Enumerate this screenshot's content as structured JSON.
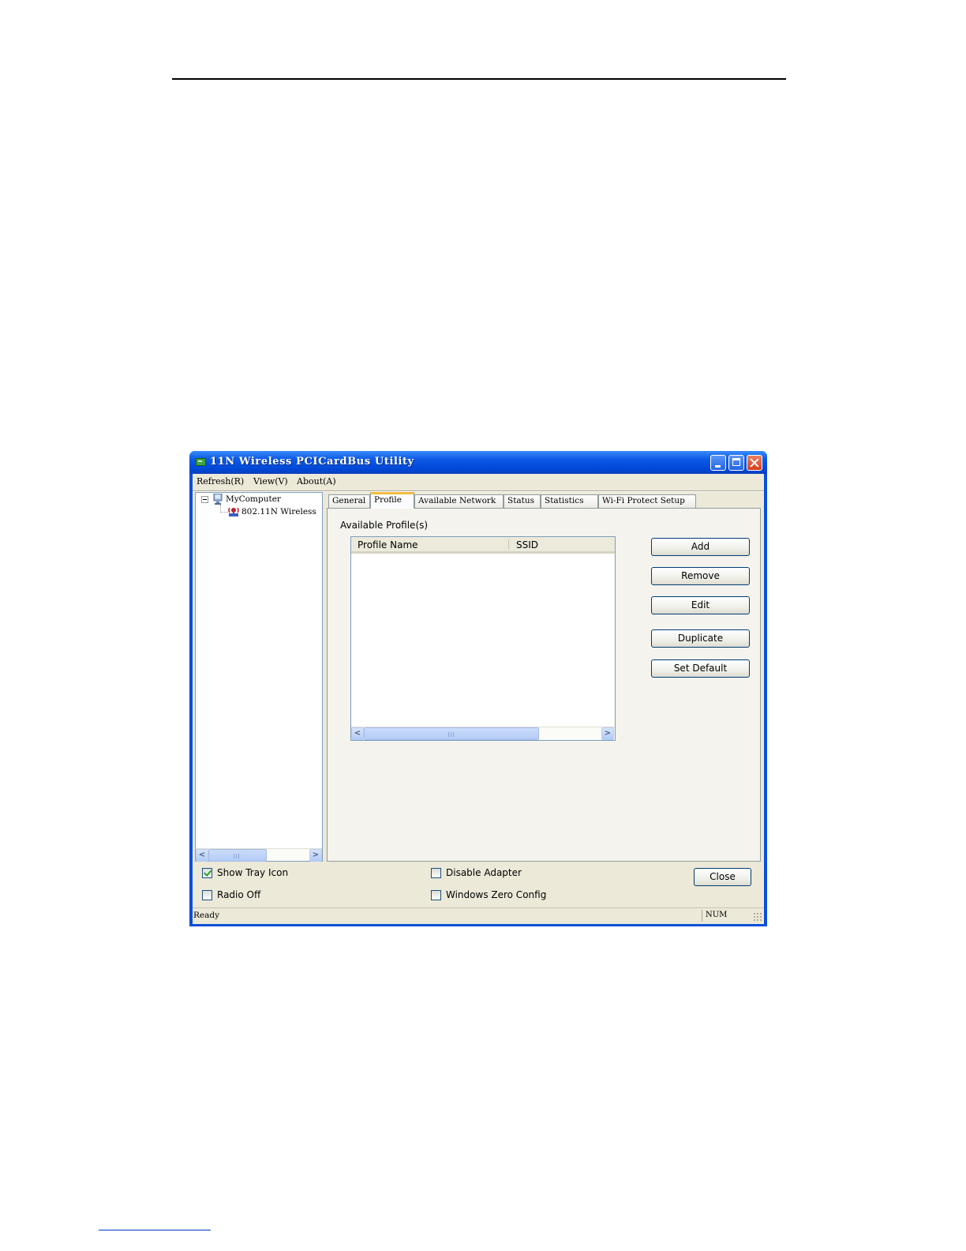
{
  "window": {
    "title": "11N Wireless PCICardBus Utility"
  },
  "menu": {
    "items": [
      "Refresh(R)",
      "View(V)",
      "About(A)"
    ]
  },
  "tree": {
    "root": "MyComputer",
    "child": "802.11N Wireless"
  },
  "tabs": [
    {
      "label": "General"
    },
    {
      "label": "Profile",
      "active": true
    },
    {
      "label": "Available Network"
    },
    {
      "label": "Status"
    },
    {
      "label": "Statistics"
    },
    {
      "label": "Wi-Fi Protect Setup"
    }
  ],
  "profile": {
    "group_label": "Available Profile(s)",
    "columns": [
      "Profile Name",
      "SSID"
    ],
    "rows": [],
    "buttons": {
      "add": "Add",
      "remove": "Remove",
      "edit": "Edit",
      "duplicate": "Duplicate",
      "set_default": "Set Default"
    }
  },
  "options": {
    "show_tray_icon": {
      "label": "Show Tray Icon",
      "checked": true
    },
    "radio_off": {
      "label": "Radio Off",
      "checked": false
    },
    "disable_adapter": {
      "label": "Disable Adapter",
      "checked": false
    },
    "windows_zero_config": {
      "label": "Windows Zero Config",
      "checked": false
    }
  },
  "close_label": "Close",
  "status": {
    "text": "Ready",
    "num": "NUM"
  },
  "colors": {
    "titlebar": "#0a50d8",
    "dialog_face": "#ece9d8",
    "active_tab_accent": "#f5ba40",
    "button_border": "#003c74"
  }
}
